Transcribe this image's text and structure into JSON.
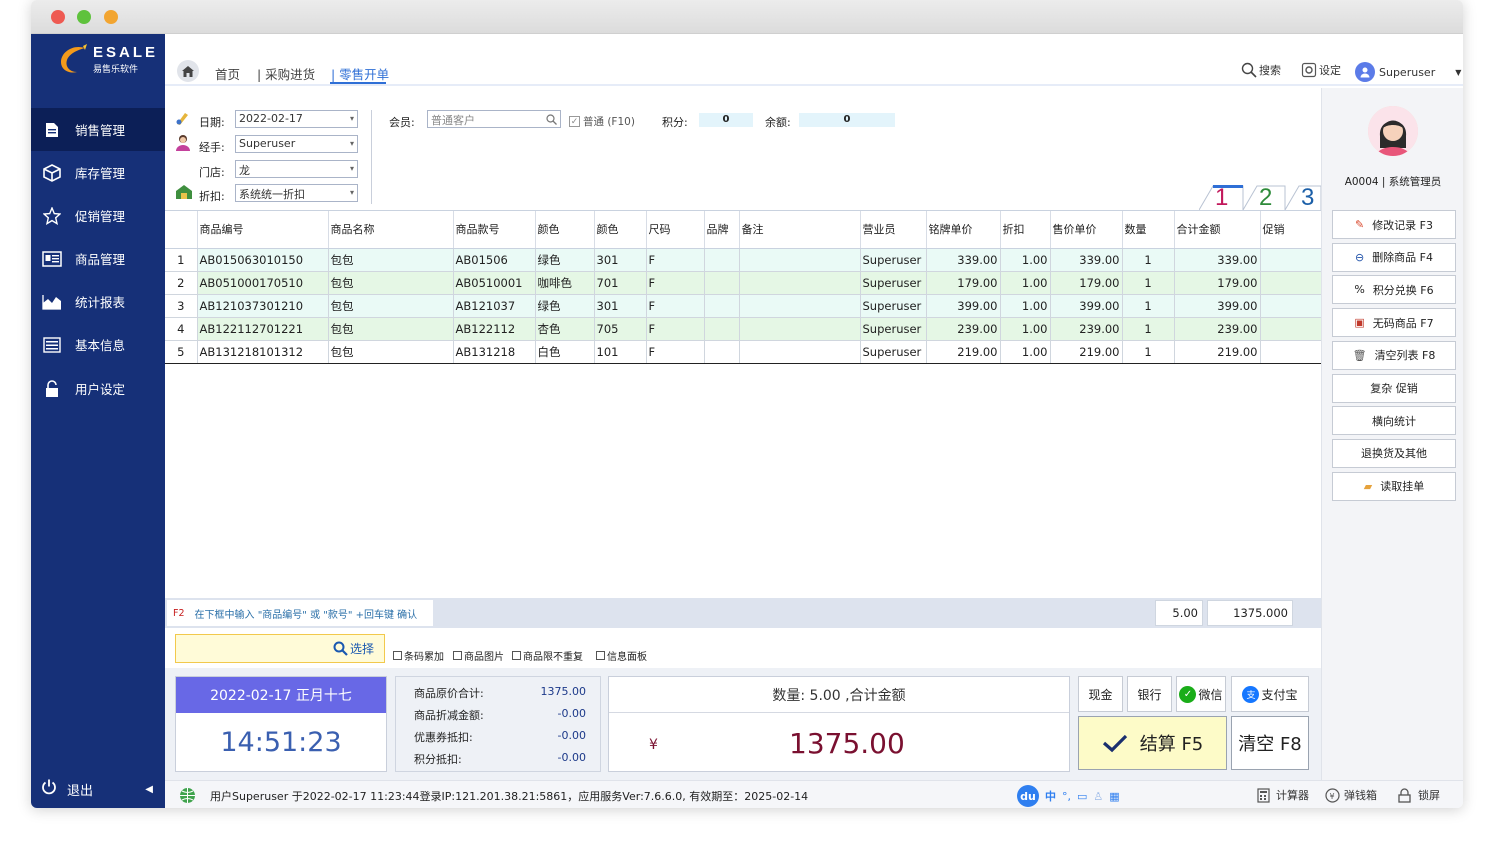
{
  "app": {
    "logo_text": "ESALE",
    "logo_sub": "易售乐软件"
  },
  "sidebar": {
    "items": [
      {
        "label": "销售管理",
        "icon": "document-icon",
        "active": true
      },
      {
        "label": "库存管理",
        "icon": "cube-icon",
        "active": false
      },
      {
        "label": "促销管理",
        "icon": "star-icon",
        "active": false
      },
      {
        "label": "商品管理",
        "icon": "product-card-icon",
        "active": false
      },
      {
        "label": "统计报表",
        "icon": "area-chart-icon",
        "active": false
      },
      {
        "label": "基本信息",
        "icon": "list-icon",
        "active": false
      },
      {
        "label": "用户设定",
        "icon": "lock-icon",
        "active": false
      }
    ],
    "logout": "退出"
  },
  "topnav": {
    "crumbs": [
      "首页",
      "| 采购进货",
      "| 零售开单"
    ],
    "search": "搜索",
    "settings": "设定",
    "user": "Superuser"
  },
  "form": {
    "date_label": "日期:",
    "date_value": "2022-02-17",
    "handler_label": "经手:",
    "handler_value": "Superuser",
    "store_label": "门店:",
    "store_value": "龙",
    "discount_label": "折扣:",
    "discount_value": "系统统一折扣",
    "member_label": "会员:",
    "member_placeholder": "普通客户",
    "normal_check": "普通 (F10)",
    "points_label": "积分:",
    "points_value": "0",
    "balance_label": "余额:",
    "balance_value": "0"
  },
  "tabs": [
    "1",
    "2",
    "3"
  ],
  "table": {
    "headers": [
      "",
      "商品编号",
      "商品名称",
      "商品款号",
      "颜色",
      "颜色",
      "尺码",
      "品牌",
      "备注",
      "营业员",
      "铭牌单价",
      "折扣",
      "售价单价",
      "数量",
      "合计金额",
      "促销"
    ],
    "rows": [
      [
        "1",
        "AB015063010150",
        "包包",
        "AB01506",
        "绿色",
        "301",
        "F",
        "",
        "",
        "Superuser",
        "339.00",
        "1.00",
        "339.00",
        "1",
        "339.00",
        ""
      ],
      [
        "2",
        "AB051000170510",
        "包包",
        "AB0510001",
        "咖啡色",
        "701",
        "F",
        "",
        "",
        "Superuser",
        "179.00",
        "1.00",
        "179.00",
        "1",
        "179.00",
        ""
      ],
      [
        "3",
        "AB121037301210",
        "包包",
        "AB121037",
        "绿色",
        "301",
        "F",
        "",
        "",
        "Superuser",
        "399.00",
        "1.00",
        "399.00",
        "1",
        "399.00",
        ""
      ],
      [
        "4",
        "AB122112701221",
        "包包",
        "AB122112",
        "杏色",
        "705",
        "F",
        "",
        "",
        "Superuser",
        "239.00",
        "1.00",
        "239.00",
        "1",
        "239.00",
        ""
      ],
      [
        "5",
        "AB131218101312",
        "包包",
        "AB131218",
        "白色",
        "101",
        "F",
        "",
        "",
        "Superuser",
        "219.00",
        "1.00",
        "219.00",
        "1",
        "219.00",
        ""
      ]
    ]
  },
  "hint": {
    "key": "F2",
    "text": "在下框中输入 \"商品编号\" 或 \"款号\" +回车键 确认",
    "qty_total": "5.00",
    "amount_total": "1375.000"
  },
  "input": {
    "select_label": "选择",
    "checks": [
      "条码累加",
      "商品图片",
      "商品限不重复",
      "信息面板"
    ]
  },
  "bottom": {
    "date": "2022-02-17  正月十七",
    "time": "14:51:23",
    "summary": [
      {
        "label": "商品原价合计:",
        "value": "1375.00"
      },
      {
        "label": "商品折减金额:",
        "value": "-0.00"
      },
      {
        "label": "优惠券抵扣:",
        "value": "-0.00"
      },
      {
        "label": "积分抵扣:",
        "value": "-0.00"
      }
    ],
    "total_head": "数量: 5.00 ,合计金额",
    "currency": "¥",
    "total_value": "1375.00",
    "pay": [
      "现金",
      "银行",
      "微信",
      "支付宝"
    ],
    "checkout": "结算 F5",
    "clear": "清空 F8"
  },
  "rightpanel": {
    "user_line": "A0004 | 系统管理员",
    "buttons": [
      {
        "label": "修改记录  F3",
        "icon": "pencil-icon"
      },
      {
        "label": "删除商品  F4",
        "icon": "minus-circle-icon"
      },
      {
        "label": "积分兑换  F6",
        "icon": "percent-icon"
      },
      {
        "label": "无码商品  F7",
        "icon": "book-icon"
      },
      {
        "label": "清空列表  F8",
        "icon": "trash-icon"
      },
      {
        "label": "复杂 促销",
        "icon": ""
      },
      {
        "label": "横向统计",
        "icon": ""
      },
      {
        "label": "退换货及其他",
        "icon": ""
      },
      {
        "label": "读取挂单",
        "icon": "folder-icon"
      }
    ]
  },
  "status": {
    "text": "用户Superuser 于2022-02-17 11:23:44登录IP:121.201.38.21:5861，应用服务Ver:7.6.6.0, 有效期至：2025-02-14",
    "ime_label": "中",
    "calculator": "计算器",
    "cashbox": "弹钱箱",
    "lock": "锁屏"
  }
}
